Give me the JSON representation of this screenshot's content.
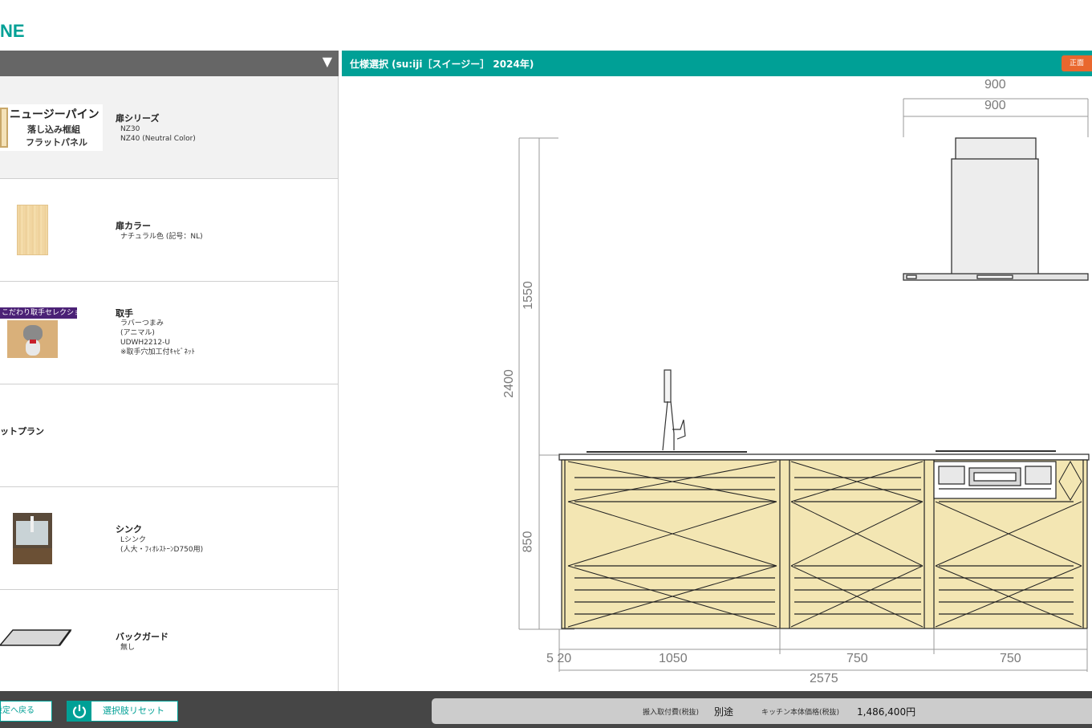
{
  "brand": {
    "logo_text": "NE"
  },
  "left_panel": {
    "collapse_icon": "▼"
  },
  "right_panel": {
    "title": "仕様選択 (su:iji［スイージー］ 2024年)",
    "view_button": "正面"
  },
  "options": [
    {
      "label": "扉シリーズ",
      "values": [
        "NZ30",
        "NZ40 (Neutral Color)"
      ],
      "thumb_text": [
        "ニュージーパイン",
        "落し込み框組",
        "フラットパネル"
      ],
      "selected": true
    },
    {
      "label": "扉カラー",
      "values": [
        "ナチュラル色 (記号：NL)"
      ]
    },
    {
      "label": "取手",
      "badge": "こだわり取手セレクション",
      "values": [
        "ラバーつまみ",
        "(アニマル)",
        "UDWH2212-U",
        "※取手穴加工付ｷｬﾋﾞﾈｯﾄ"
      ]
    },
    {
      "label": "ットプラン",
      "values": []
    },
    {
      "label": "シンク",
      "values": [
        "Lシンク",
        "(人大・ﾌｨｵﾚｽﾄｰﾝD750用)"
      ]
    },
    {
      "label": "バックガード",
      "values": [
        "無し"
      ]
    }
  ],
  "drawing": {
    "dims": {
      "hood_outer": "900",
      "hood_inner": "900",
      "total_height": "2400",
      "upper_height": "1550",
      "counter_height": "850",
      "left_small": "5 20",
      "sink_width": "1050",
      "mid_width": "750",
      "right_width": "750",
      "total_width": "2575"
    }
  },
  "footer": {
    "back_button": "設定へ戻る",
    "reset_button": "選択肢リセット",
    "install_fee_label": "搬入取付費(税抜)",
    "install_fee_value": "別途",
    "price_label": "キッチン本体価格(税抜)",
    "price_value": "1,486,400円"
  },
  "colors": {
    "accent": "#00a096",
    "header_gray": "#666666",
    "footer_dark": "#464646",
    "view_button": "#e9672e",
    "badge_purple": "#4b2176",
    "cabinet_fill": "#f3e6b3"
  }
}
